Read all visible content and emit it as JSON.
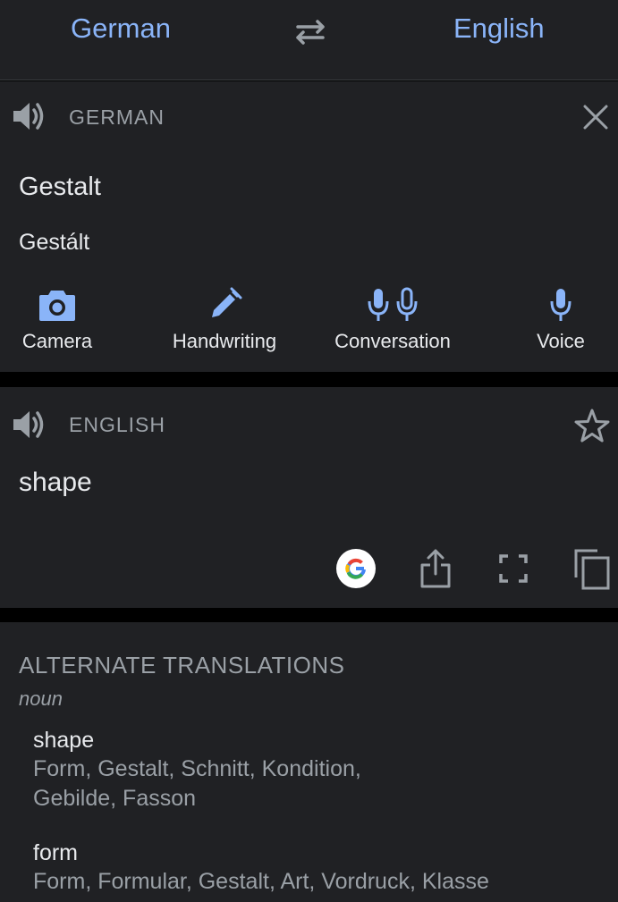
{
  "language_bar": {
    "source_language": "German",
    "target_language": "English",
    "swap_icon": "swap-arrows-icon"
  },
  "source": {
    "language_label": "GERMAN",
    "text": "Gestalt",
    "transliteration": "Gestált",
    "tools": [
      {
        "label": "Camera",
        "icon": "camera-icon"
      },
      {
        "label": "Handwriting",
        "icon": "pen-icon"
      },
      {
        "label": "Conversation",
        "icon": "double-mic-icon"
      },
      {
        "label": "Voice",
        "icon": "mic-icon"
      }
    ]
  },
  "translation": {
    "language_label": "ENGLISH",
    "text": "shape",
    "actions": [
      "google-icon",
      "share-icon",
      "fullscreen-icon",
      "copy-icon"
    ]
  },
  "alternates": {
    "heading": "ALTERNATE TRANSLATIONS",
    "part_of_speech": "noun",
    "entries": [
      {
        "word": "shape",
        "synonyms_line1": "Form, Gestalt, Schnitt, Kondition,",
        "synonyms_line2": "Gebilde, Fasson"
      },
      {
        "word": "form",
        "synonyms_line1": "Form, Formular, Gestalt, Art, Vordruck, Klasse"
      }
    ]
  },
  "colors": {
    "accent": "#8ab4f8",
    "surface": "#202124",
    "background": "#000000",
    "secondary_text": "#9aa0a6",
    "primary_text": "#e8eaed"
  }
}
